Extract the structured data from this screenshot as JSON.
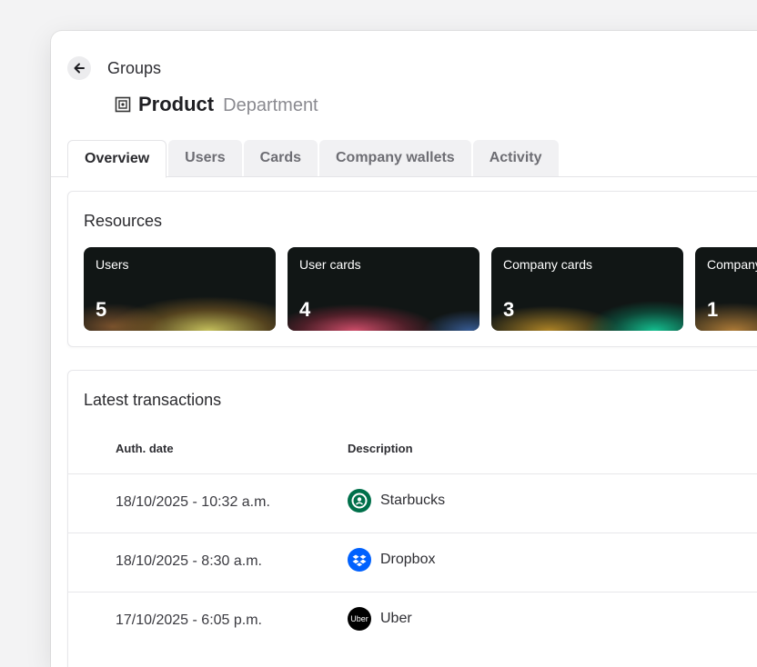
{
  "breadcrumb": {
    "label": "Groups"
  },
  "page": {
    "title": "Product",
    "subtitle": "Department"
  },
  "tabs": [
    {
      "label": "Overview",
      "active": true
    },
    {
      "label": "Users"
    },
    {
      "label": "Cards"
    },
    {
      "label": "Company wallets"
    },
    {
      "label": "Activity"
    }
  ],
  "resources": {
    "title": "Resources",
    "cards": [
      {
        "label": "Users",
        "value": "5"
      },
      {
        "label": "User cards",
        "value": "4"
      },
      {
        "label": "Company cards",
        "value": "3"
      },
      {
        "label": "Company",
        "value": "1"
      }
    ]
  },
  "transactions": {
    "title": "Latest transactions",
    "columns": {
      "date": "Auth. date",
      "description": "Description"
    },
    "rows": [
      {
        "date": "18/10/2025 - 10:32 a.m.",
        "merchant": "Starbucks",
        "logo": "starbucks-logo"
      },
      {
        "date": "18/10/2025 - 8:30 a.m.",
        "merchant": "Dropbox",
        "logo": "dropbox-logo"
      },
      {
        "date": "17/10/2025 - 6:05 p.m.",
        "merchant": "Uber",
        "logo": "uber-logo",
        "logo_text": "Uber"
      }
    ]
  },
  "colors": {
    "starbucks": "#00704a",
    "dropbox": "#0061fe",
    "uber": "#000000"
  }
}
